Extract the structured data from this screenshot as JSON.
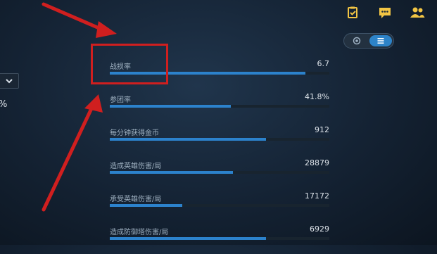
{
  "colors": {
    "accent": "#2c82cc",
    "annotation": "#d01f1f",
    "background": "#142233"
  },
  "top_icons": [
    "task-icon",
    "chat-icon",
    "friends-icon"
  ],
  "view_toggle": {
    "options": [
      "circle-icon",
      "list-icon"
    ],
    "active": 1
  },
  "left_panel": {
    "dropdown_icon": "chevron-down-icon",
    "percent_text": "%"
  },
  "stats": [
    {
      "label": "战损率",
      "value": "6.7",
      "fill": 0.89
    },
    {
      "label": "参团率",
      "value": "41.8%",
      "fill": 0.55
    },
    {
      "label": "每分钟获得金币",
      "value": "912",
      "fill": 0.71
    },
    {
      "label": "造成英雄伤害/局",
      "value": "28879",
      "fill": 0.56
    },
    {
      "label": "承受英雄伤害/局",
      "value": "17172",
      "fill": 0.33
    },
    {
      "label": "造成防御塔伤害/局",
      "value": "6929",
      "fill": 0.71
    }
  ]
}
